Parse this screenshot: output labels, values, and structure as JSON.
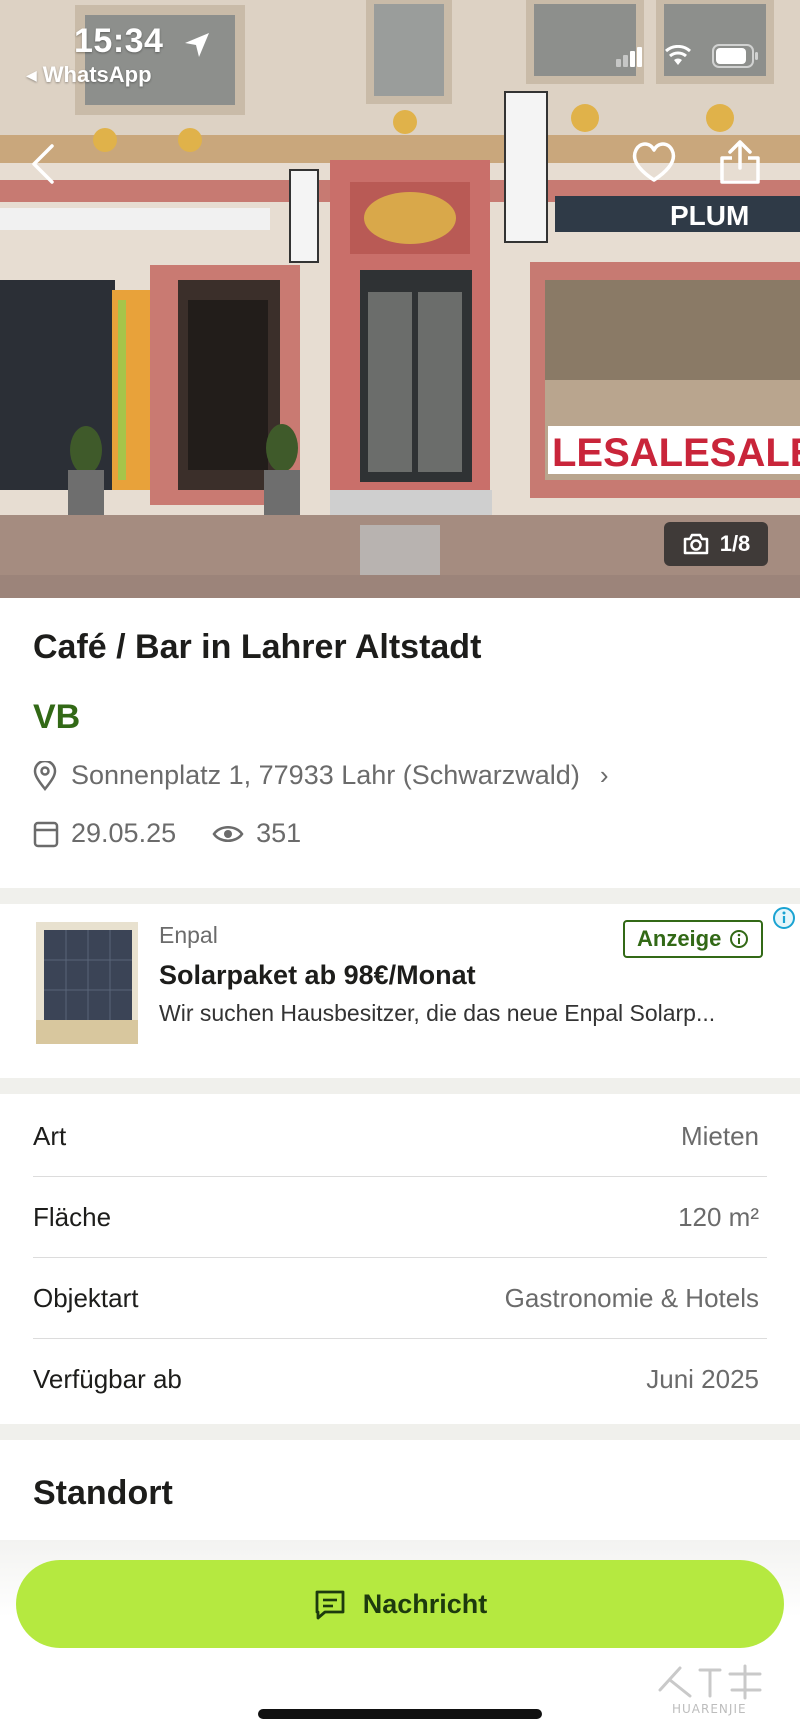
{
  "status_bar": {
    "time": "15:34",
    "back_app": "WhatsApp"
  },
  "gallery": {
    "counter": "1/8",
    "shop_sign": "PLUM",
    "window_text": "LESALESALESALESAL"
  },
  "listing": {
    "title": "Café / Bar in Lahrer Altstadt",
    "price": "VB",
    "address": "Sonnenplatz 1, 77933 Lahr (Schwarzwald)",
    "date": "29.05.25",
    "views": "351"
  },
  "ad": {
    "brand": "Enpal",
    "title": "Solarpaket ab 98€/Monat",
    "description": "Wir suchen Hausbesitzer, die das neue Enpal Solarp...",
    "badge": "Anzeige"
  },
  "details": [
    {
      "key": "Art",
      "value": "Mieten"
    },
    {
      "key": "Fläche",
      "value": "120 m²"
    },
    {
      "key": "Objektart",
      "value": "Gastronomie & Hotels"
    },
    {
      "key": "Verfügbar ab",
      "value": "Juni 2025"
    }
  ],
  "section": {
    "location_title": "Standort"
  },
  "action": {
    "message_label": "Nachricht"
  },
  "watermark": {
    "text": "HUARENJIE"
  },
  "colors": {
    "accent_green": "#b5e940",
    "price_green": "#326916",
    "text_grey": "#6b6b6b"
  }
}
